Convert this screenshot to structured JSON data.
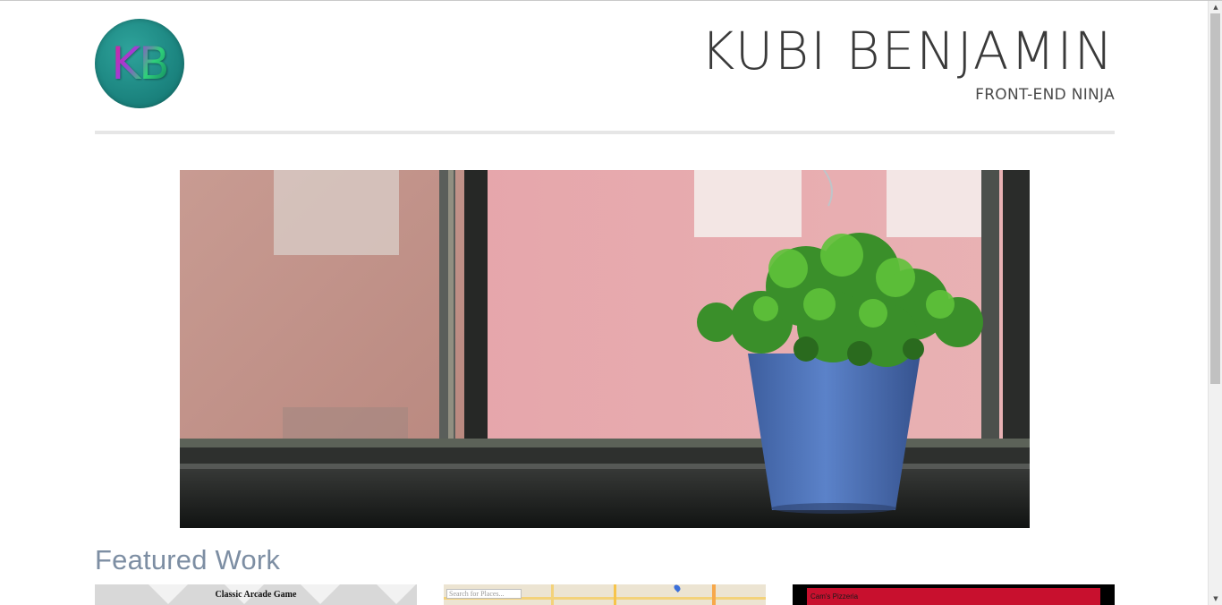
{
  "header": {
    "logo_text": "KB",
    "title": "KUBI BENJAMIN",
    "subtitle": "FRONT-END NINJA"
  },
  "hero": {
    "image_subject": "potted-plant-on-window-sill"
  },
  "featured": {
    "heading": "Featured Work",
    "cards": [
      {
        "label": "Classic Arcade Game"
      },
      {
        "label": "Search for Places..."
      },
      {
        "label": "Cam's Pizzeria"
      }
    ]
  },
  "scrollbar": {
    "up_icon": "▲",
    "down_icon": "▼"
  },
  "colors": {
    "logo_bg": "#1c8580",
    "heading": "#7d8ea3",
    "divider": "#e6e6e6",
    "pizzeria_red": "#c8102e"
  }
}
